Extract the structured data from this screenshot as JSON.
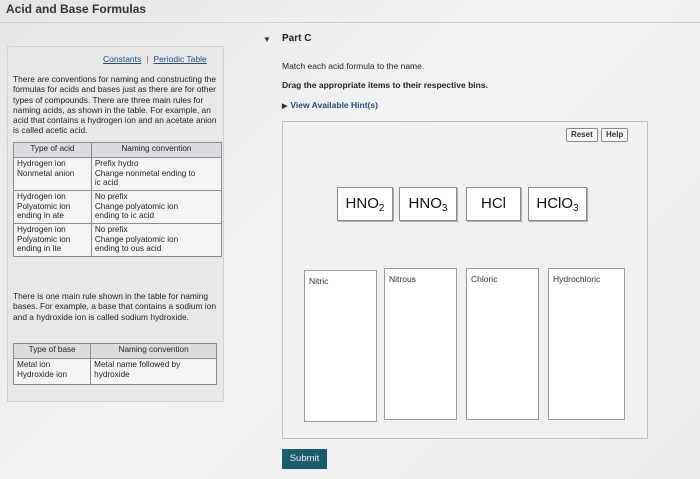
{
  "page": {
    "title": "Acid and Base Formulas"
  },
  "info": {
    "links": [
      "Constants",
      "Periodic Table"
    ],
    "para1": "There are conventions for naming and constructing the formulas for acids and bases just as there are for other types of compounds. There are three main rules for naming acids, as shown in the table. For example, an acid that contains a hydrogen ion and an acetate anion is called acetic acid.",
    "acid_table": {
      "headers": [
        "Type of acid",
        "Naming convention"
      ],
      "rows": [
        [
          "Hydrogen ion\nNonmetal anion",
          "Prefix hydro\nChange nonmetal ending to\nic acid"
        ],
        [
          "Hydrogen ion\nPolyatomic ion\nending in ate",
          "No prefix\nChange polyatomic ion\nending to ic acid"
        ],
        [
          "Hydrogen ion\nPolyatomic ion\nending in ite",
          "No prefix\nChange polyatomic ion\nending to ous acid"
        ]
      ]
    },
    "para2": "There is one main rule shown in the table for naming bases. For example, a base that contains a sodium ion and a hydroxide ion is called sodium hydroxide.",
    "base_table": {
      "headers": [
        "Type of base",
        "Naming convention"
      ],
      "rows": [
        [
          "Metal ion\nHydroxide ion",
          "Metal name followed by\nhydroxide"
        ]
      ]
    }
  },
  "part": {
    "title": "Part C",
    "instruction": "Match each acid formula to the name.",
    "instruction_bold": "Drag the appropriate items to their respective bins.",
    "hints_label": "View Available Hint(s)"
  },
  "workspace": {
    "reset_label": "Reset",
    "help_label": "Help",
    "tiles": [
      {
        "base": "HNO",
        "sub": "2"
      },
      {
        "base": "HNO",
        "sub": "3"
      },
      {
        "base": "HCl",
        "sub": ""
      },
      {
        "base": "HClO",
        "sub": "3"
      }
    ],
    "bins": [
      "Nitric",
      "Nitrous",
      "Chloric",
      "Hydrochloric"
    ]
  },
  "submit_label": "Submit",
  "colors": {
    "submit_bg": "#1c5a6d",
    "link": "#2c4a7a"
  }
}
